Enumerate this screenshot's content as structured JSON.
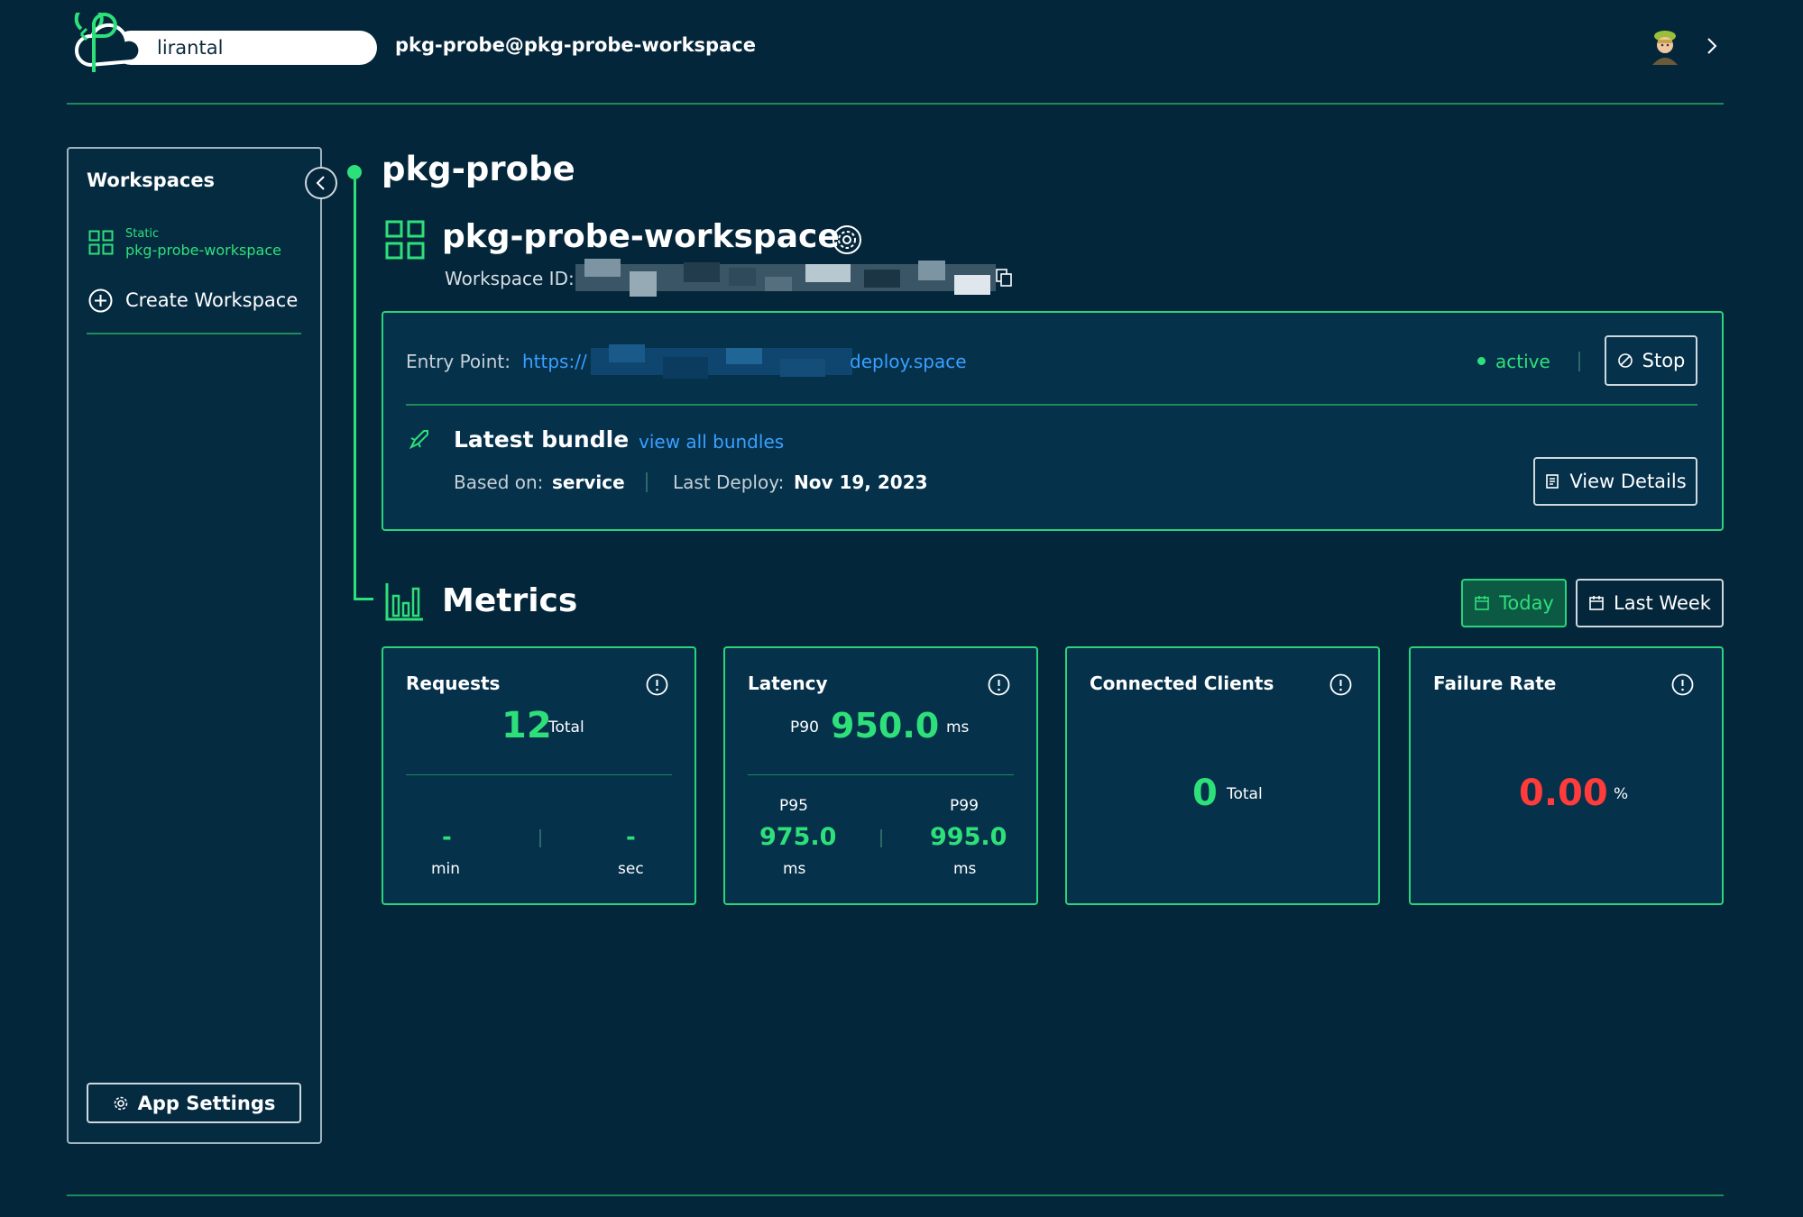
{
  "header": {
    "username": "lirantal",
    "workspace_email": "pkg-probe@pkg-probe-workspace",
    "icons": [
      "logo-icon",
      "avatar",
      "chevron-right-icon"
    ]
  },
  "sidebar": {
    "title": "Workspaces",
    "workspaces": [
      {
        "type": "Static",
        "name": "pkg-probe-workspace"
      }
    ],
    "create_label": "Create Workspace",
    "settings_label": "App Settings"
  },
  "project": {
    "name": "pkg-probe",
    "workspace_title": "pkg-probe-workspace",
    "workspace_id_label": "Workspace ID:"
  },
  "entry": {
    "label": "Entry Point:",
    "url_prefix": "https://",
    "url_suffix": "deploy.space",
    "status": "active",
    "stop_label": "Stop"
  },
  "bundle": {
    "title": "Latest bundle",
    "view_all_label": "view all bundles",
    "based_on_label": "Based on:",
    "based_on_value": "service",
    "last_deploy_label": "Last Deploy:",
    "last_deploy_value": "Nov 19, 2023",
    "view_details_label": "View Details"
  },
  "metrics": {
    "title": "Metrics",
    "range_buttons": {
      "today": "Today",
      "last_week": "Last Week"
    },
    "selected_range": "Today",
    "requests": {
      "title": "Requests",
      "total": "12",
      "total_label": "Total",
      "per_min": "-",
      "per_min_label": "min",
      "per_sec": "-",
      "per_sec_label": "sec"
    },
    "latency": {
      "title": "Latency",
      "p90_label": "P90",
      "p90_value": "950.0",
      "p90_unit": "ms",
      "p95_label": "P95",
      "p95_value": "975.0",
      "p95_unit": "ms",
      "p99_label": "P99",
      "p99_value": "995.0",
      "p99_unit": "ms"
    },
    "connected_clients": {
      "title": "Connected Clients",
      "value": "0",
      "label": "Total"
    },
    "failure_rate": {
      "title": "Failure Rate",
      "value": "0.00",
      "unit": "%"
    }
  },
  "colors": {
    "background": "#04263a",
    "panel": "#05314b",
    "accent_green": "#2ee07a",
    "link_blue": "#3aa0ff",
    "failure_red": "#ff3b3b",
    "border_green": "#2bd47a"
  }
}
